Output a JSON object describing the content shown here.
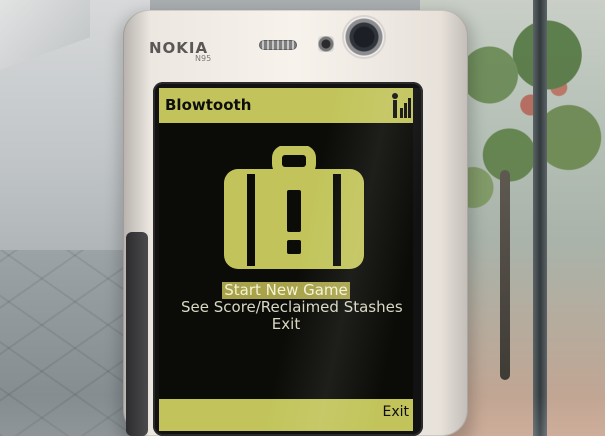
{
  "device": {
    "brand": "NOKIA",
    "model": "N95"
  },
  "screen": {
    "app_title": "Blowtooth",
    "menu": {
      "items": [
        {
          "label": "Start New Game",
          "selected": true
        },
        {
          "label": "See Score/Reclaimed Stashes",
          "selected": false
        },
        {
          "label": "Exit",
          "selected": false
        }
      ]
    },
    "softkeys": {
      "right": "Exit"
    },
    "icons": {
      "title_right": "signal-icon",
      "center": "briefcase-warning-icon"
    },
    "colors": {
      "lcd_bar": "#c2c45b",
      "lcd_bg": "#0b0b08",
      "menu_highlight": "#a8a34b",
      "menu_text": "#d9d8c3"
    }
  }
}
